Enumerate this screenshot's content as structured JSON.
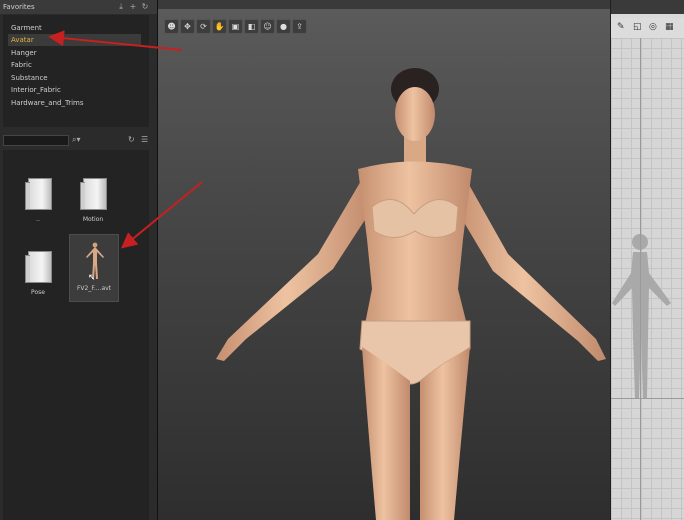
{
  "favorites": {
    "title": "Favorites",
    "items": [
      {
        "label": "Garment",
        "selected": false
      },
      {
        "label": "Avatar",
        "selected": true
      },
      {
        "label": "Hanger",
        "selected": false
      },
      {
        "label": "Fabric",
        "selected": false
      },
      {
        "label": "Substance",
        "selected": false
      },
      {
        "label": "Interior_Fabric",
        "selected": false
      },
      {
        "label": "Hardware_and_Trims",
        "selected": false
      }
    ]
  },
  "library": {
    "search_placeholder": "",
    "tiles": [
      {
        "label": "..",
        "kind": "folder"
      },
      {
        "label": "Motion",
        "kind": "folder"
      },
      {
        "label": "Pose",
        "kind": "folder"
      },
      {
        "label": "FV2_F....avt",
        "kind": "avatar"
      }
    ]
  },
  "icons": {
    "download": "download-icon",
    "add": "plus-icon",
    "refresh": "refresh-icon",
    "search": "search-icon",
    "list_view": "list-view-icon"
  },
  "colors": {
    "selected_text": "#e2b33c",
    "arrow": "#c62020",
    "skin": "#e3b592"
  }
}
